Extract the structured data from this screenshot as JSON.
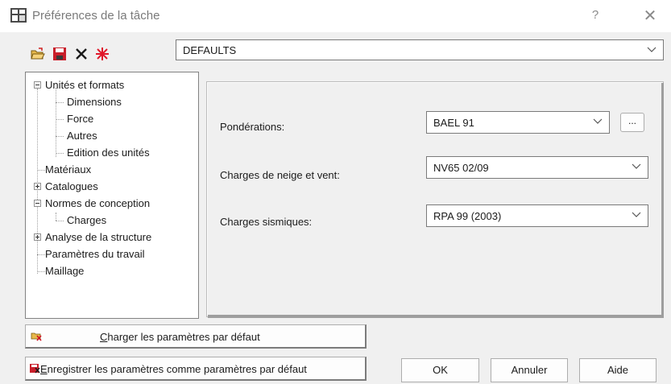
{
  "window": {
    "title": "Préférences de la tâche",
    "help": "?",
    "close": "✕"
  },
  "toolbar": {
    "icons": [
      "open-folder-icon",
      "save-icon",
      "delete-icon",
      "new-star-icon"
    ]
  },
  "preset": {
    "value": "DEFAULTS"
  },
  "tree": {
    "items": [
      {
        "label": "Unités et formats",
        "expander": "minus"
      },
      {
        "label": "Dimensions"
      },
      {
        "label": "Force"
      },
      {
        "label": "Autres"
      },
      {
        "label": "Edition des unités"
      },
      {
        "label": "Matériaux"
      },
      {
        "label": "Catalogues",
        "expander": "plus"
      },
      {
        "label": "Normes de conception",
        "expander": "minus"
      },
      {
        "label": "Charges",
        "selected": true
      },
      {
        "label": "Analyse de la structure",
        "expander": "plus"
      },
      {
        "label": "Paramètres du travail"
      },
      {
        "label": "Maillage"
      }
    ]
  },
  "form": {
    "ponderations": {
      "label": "Pondérations:",
      "value": "BAEL 91",
      "button": "..."
    },
    "neige_vent": {
      "label": "Charges de neige et vent:",
      "value": "NV65 02/09"
    },
    "sismiques": {
      "label": "Charges sismiques:",
      "value": "RPA 99 (2003)"
    }
  },
  "buttons": {
    "load_defaults_prefix": "C",
    "load_defaults_rest": "harger les paramètres par défaut",
    "save_defaults_prefix": "E",
    "save_defaults_rest": "nregistrer les paramètres comme paramètres par défaut",
    "ok": "OK",
    "cancel": "Annuler",
    "help": "Aide"
  }
}
